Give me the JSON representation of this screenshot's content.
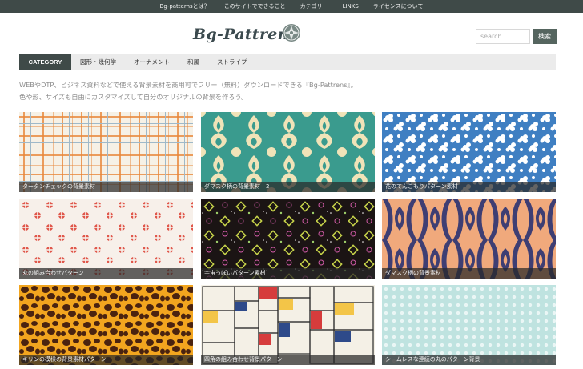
{
  "topnav": {
    "items": [
      "Bg-patternsとは？",
      "このサイトでできること",
      "カテゴリー",
      "LINKS",
      "ライセンスについて"
    ]
  },
  "header": {
    "logo_text": "Bg-Pattrens",
    "search_placeholder": "search",
    "search_button": "検索"
  },
  "category_nav": {
    "active": "CATEGORY",
    "items": [
      "図形・幾何学",
      "オーナメント",
      "和風",
      "ストライプ"
    ]
  },
  "intro": {
    "line1": "WEBやDTP、ビジネス資料などで使える背景素材を商用可でフリー（無料）ダウンロードできる『Bg-Pattrens』。",
    "line2": "色や形、サイズも自由にカスタマイズして自分のオリジナルの背景を作ろう。"
  },
  "tiles": [
    {
      "caption": "タータンチェックの背景素材"
    },
    {
      "caption": "ダマスク柄の背景素材　2"
    },
    {
      "caption": "花のてんこもりパターン素材"
    },
    {
      "caption": "丸の組み合わせパターン"
    },
    {
      "caption": "宇宙っぽいパターン素材"
    },
    {
      "caption": "ダマスク柄の背景素材"
    },
    {
      "caption": "キリンの模様の背景素材パターン"
    },
    {
      "caption": "四角の組み合わせ背景パターン"
    },
    {
      "caption": "シームレスな連続の丸のパターン背景"
    }
  ],
  "colors": {
    "topbar": "#3f4a48",
    "accent": "#55655f",
    "tartan": "#e8873a",
    "damask_teal": "#3a9b8e",
    "flower_blue": "#3f7fc2",
    "circle_red": "#e0564a",
    "space_bg": "#1b1414",
    "damask_navy": "#3e3e73",
    "giraffe": "#f2a51f",
    "dots_bg": "#bfe3e0"
  }
}
